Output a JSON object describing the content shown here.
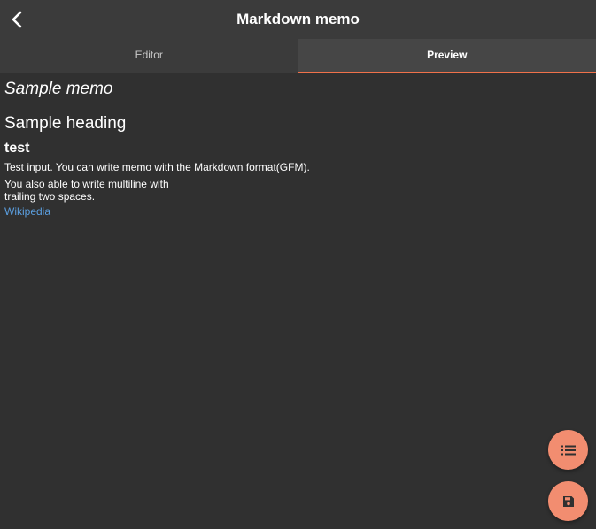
{
  "header": {
    "title": "Markdown memo",
    "back_icon": "chevron-left-icon"
  },
  "tabs": [
    {
      "label": "Editor",
      "active": false
    },
    {
      "label": "Preview",
      "active": true
    }
  ],
  "preview": {
    "memo_title": "Sample memo",
    "heading": "Sample heading",
    "subheading": "test",
    "paragraph1": "Test input. You can write memo with the Markdown format(GFM).",
    "paragraph2_line1": "You also able to write multiline with",
    "paragraph2_line2": "trailing two spaces.",
    "link_text": "Wikipedia"
  },
  "fabs": {
    "list_icon": "list-icon",
    "save_icon": "save-icon"
  },
  "colors": {
    "background": "#303030",
    "header": "#3b3b3b",
    "accent": "#f0714a",
    "fab": "#f28d70",
    "link": "#5b9fe0"
  }
}
